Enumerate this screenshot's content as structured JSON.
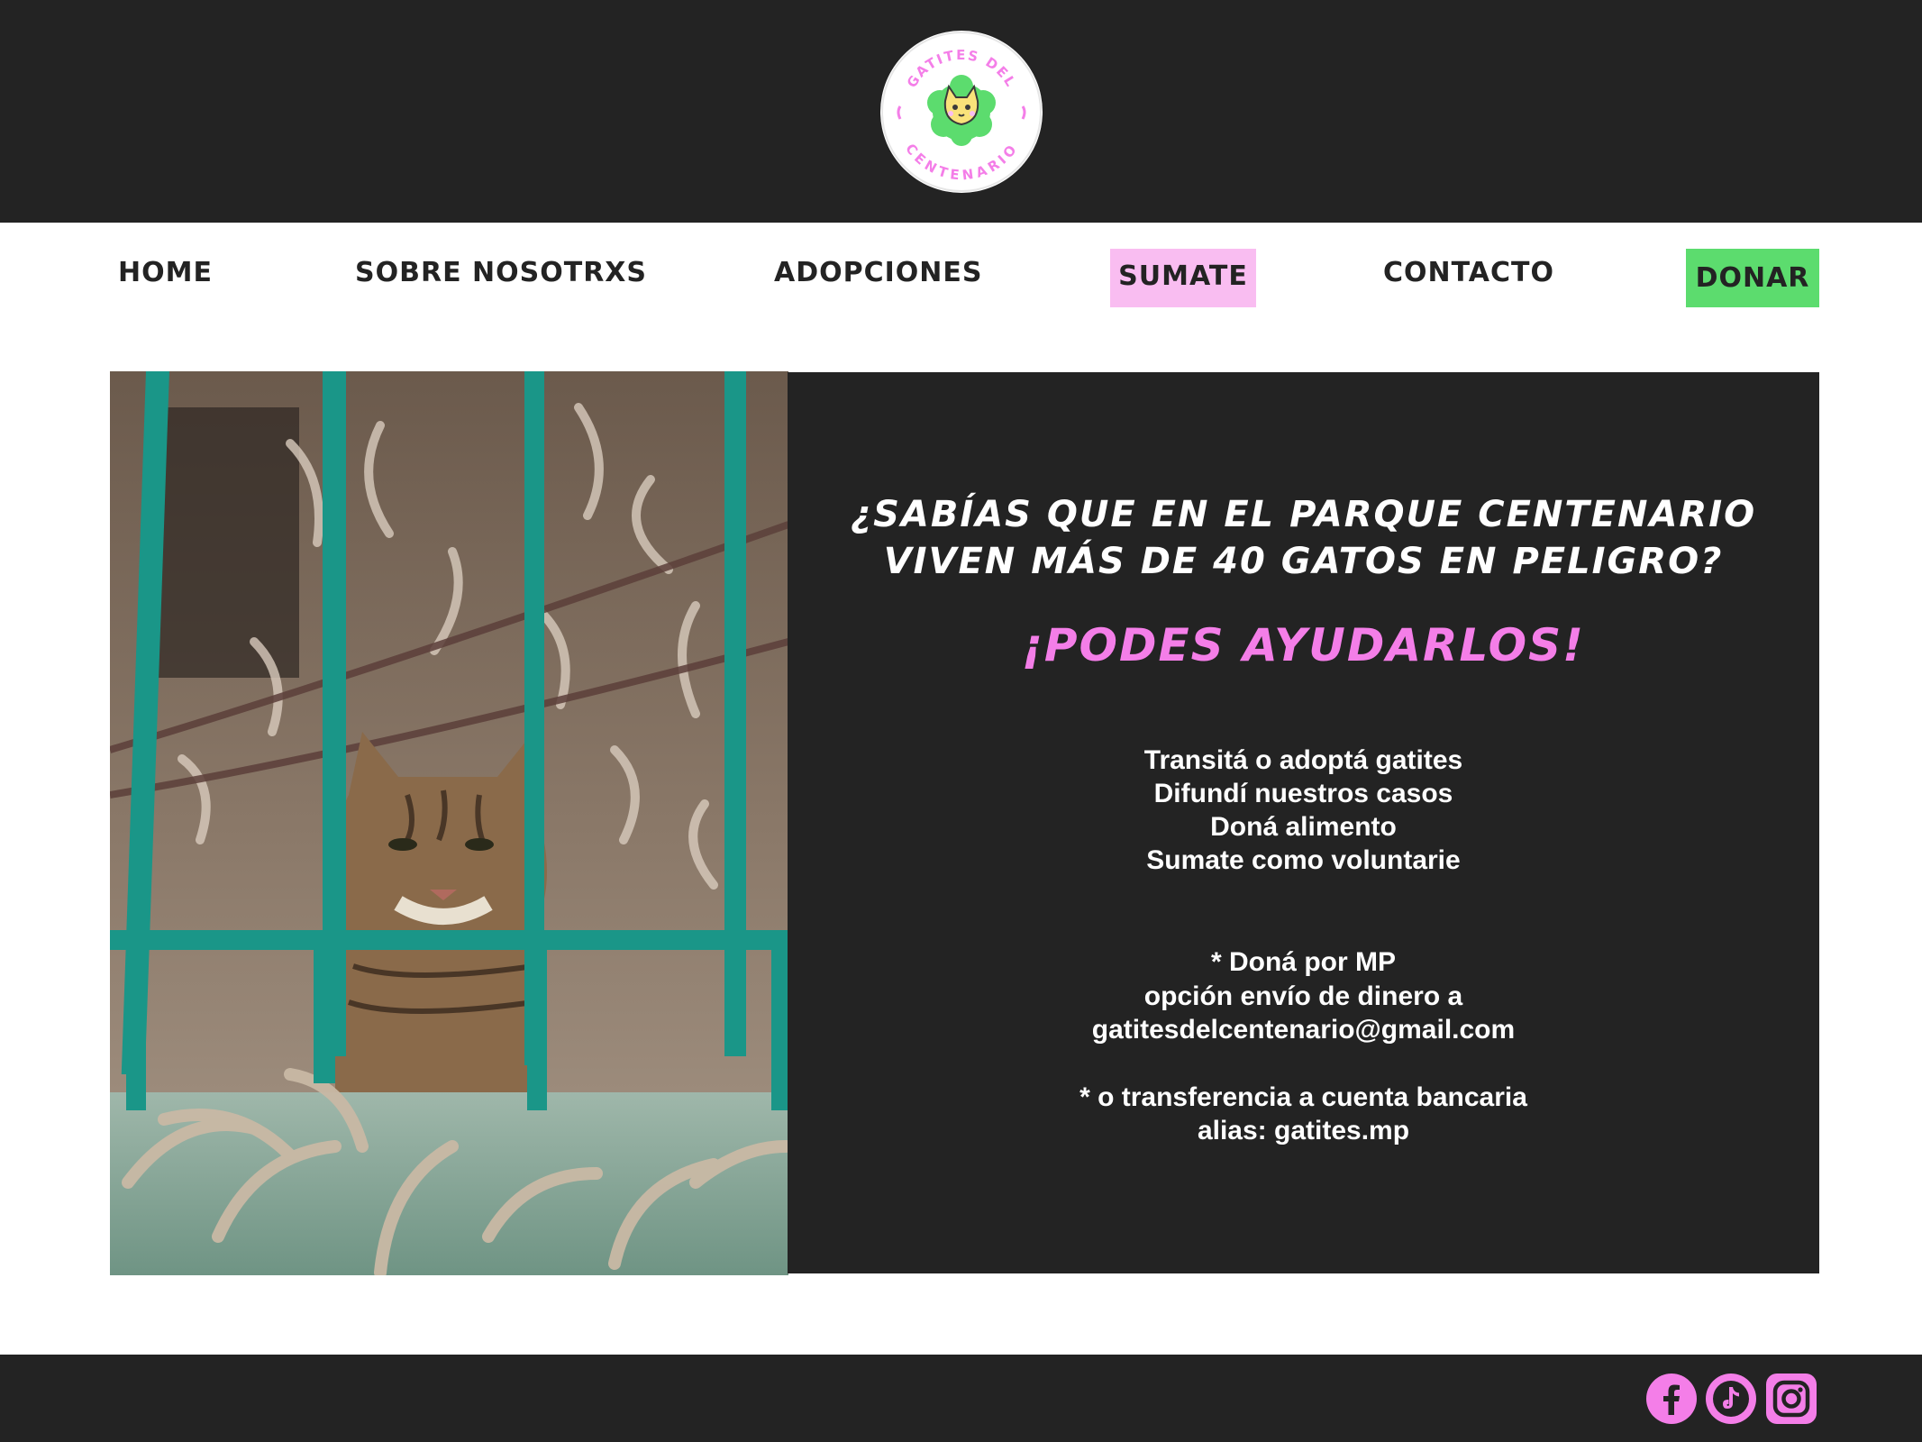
{
  "logo": {
    "text_top": "GATITES DEL",
    "text_bottom": "CENTENARIO",
    "colors": {
      "green": "#5cdc6e",
      "pink": "#f47ee8",
      "yellow": "#f9e27a"
    }
  },
  "nav": {
    "items": [
      {
        "label": "HOME"
      },
      {
        "label": "SOBRE NOSOTRXS"
      },
      {
        "label": "ADOPCIONES"
      },
      {
        "label": "SUMATE"
      },
      {
        "label": "CONTACTO"
      },
      {
        "label": "DONAR"
      }
    ]
  },
  "hero": {
    "headline_line1": "¿Sabías que en el Parque Centenario",
    "headline_line2": "viven más de 40 gatos en peligro?",
    "cta": "¡Podes ayudarlos!",
    "ways": [
      "Transitá o adoptá gatites",
      "Difundí nuestros casos",
      "Doná alimento",
      "Sumate como voluntarie"
    ],
    "donate_mp_1": "* Doná por MP",
    "donate_mp_2": "opción envío de dinero a",
    "donate_email": "gatitesdelcentenario@gmail.com",
    "donate_bank_1": "* o transferencia a cuenta bancaria",
    "donate_bank_2": "alias: gatites.mp"
  },
  "footer": {
    "social_icons": [
      "facebook-icon",
      "tiktok-icon",
      "instagram-icon"
    ]
  },
  "colors": {
    "dark": "#232323",
    "pink_accent": "#f47ee8",
    "pink_button": "#f9bdf1",
    "green_button": "#5cdc6e"
  }
}
